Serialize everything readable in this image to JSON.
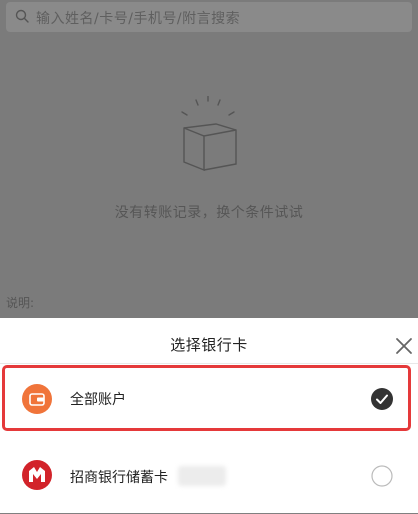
{
  "background_page": {
    "search_placeholder": "输入姓名/卡号/手机号/附言搜索",
    "empty_message": "没有转账记录，换个条件试试",
    "note_label": "说明:"
  },
  "sheet": {
    "title": "选择银行卡",
    "options": [
      {
        "label": "全部账户",
        "icon": "wallet-icon",
        "selected": true
      },
      {
        "label": "招商银行储蓄卡",
        "icon": "cmb-logo-icon",
        "selected": false
      }
    ]
  },
  "colors": {
    "accent_orange": "#f0743a",
    "highlight_red": "#e5393a",
    "cmb_red": "#d2232a",
    "check_dark": "#333333"
  }
}
